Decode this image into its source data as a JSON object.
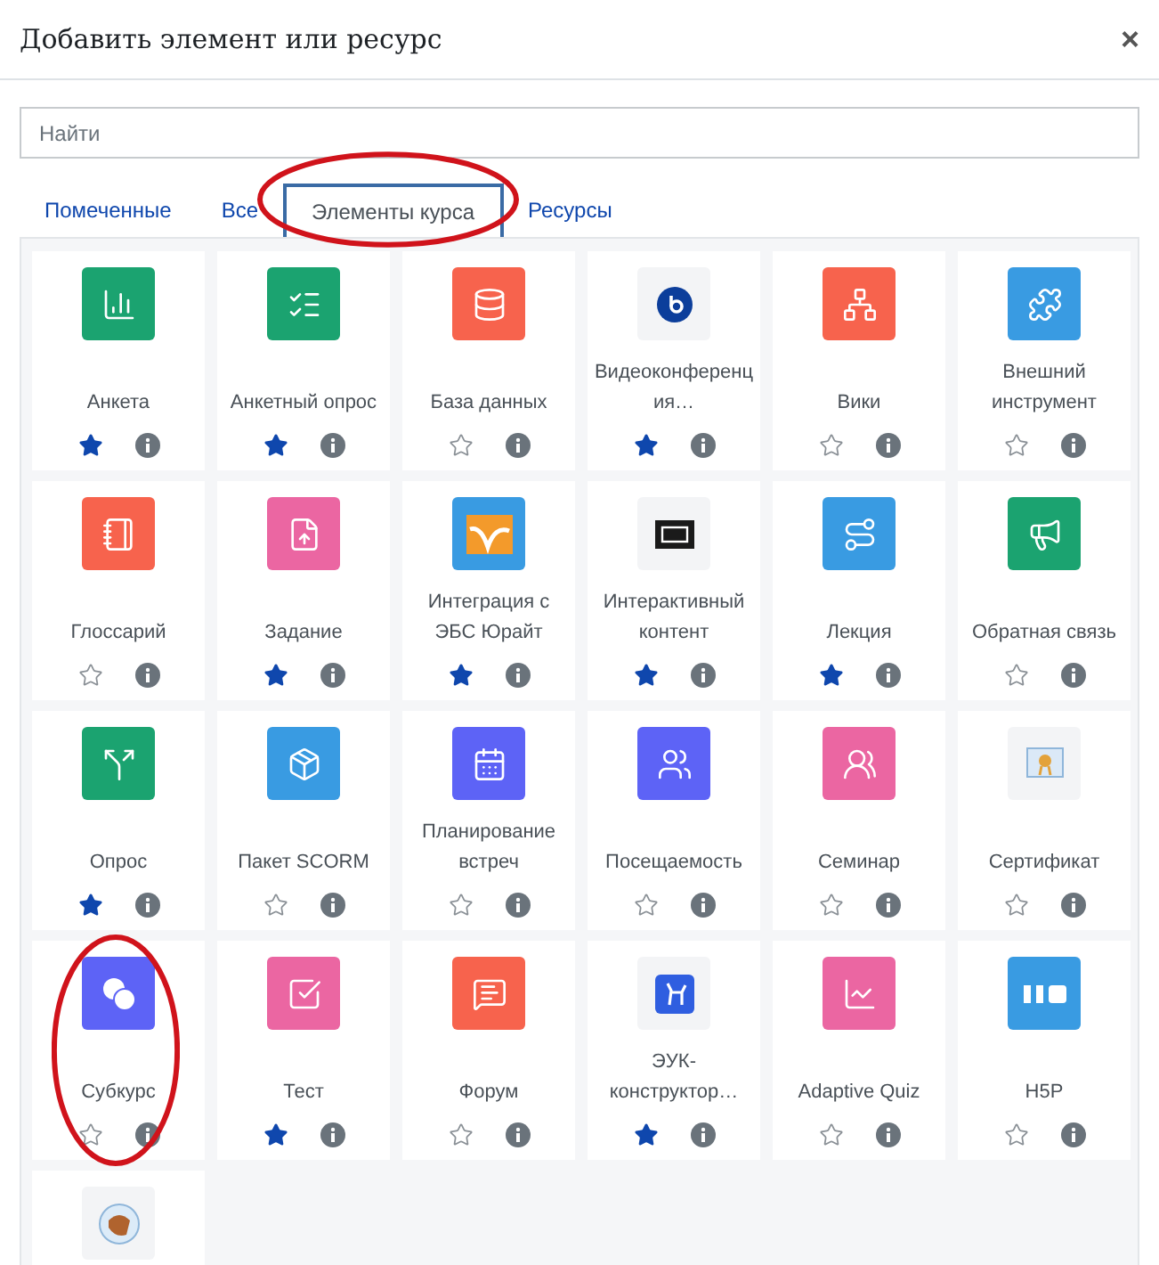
{
  "dialog": {
    "title": "Добавить элемент или ресурс",
    "close": "×"
  },
  "search": {
    "placeholder": "Найти"
  },
  "tabs": [
    {
      "label": "Помеченные",
      "selected": false,
      "circled": false
    },
    {
      "label": "Все",
      "selected": false,
      "circled": false
    },
    {
      "label": "Элементы курса",
      "selected": true,
      "circled": true
    },
    {
      "label": "Ресурсы",
      "selected": false,
      "circled": false
    }
  ],
  "items": [
    {
      "label": "Анкета",
      "starred": true,
      "kind": "tile",
      "color": "#1ba370",
      "circled": false
    },
    {
      "label": "Анкетный опрос",
      "starred": true,
      "kind": "tile",
      "color": "#1ba370",
      "circled": false
    },
    {
      "label": "База данных",
      "starred": false,
      "kind": "tile",
      "color": "#f7634d",
      "circled": false
    },
    {
      "label": "Видеоконференция…",
      "starred": true,
      "kind": "logo",
      "circled": false
    },
    {
      "label": "Вики",
      "starred": false,
      "kind": "tile",
      "color": "#f7634d",
      "circled": false
    },
    {
      "label": "Внешний инструмент",
      "starred": false,
      "kind": "tile",
      "color": "#399be2",
      "circled": false
    },
    {
      "label": "Глоссарий",
      "starred": false,
      "kind": "tile",
      "color": "#f7634d",
      "circled": false
    },
    {
      "label": "Задание",
      "starred": true,
      "kind": "tile",
      "color": "#eb66a2",
      "circled": false
    },
    {
      "label": "Интеграция с ЭБС Юрайт",
      "starred": true,
      "kind": "tile",
      "color": "#399be2",
      "circled": false
    },
    {
      "label": "Интерактивный контент",
      "starred": true,
      "kind": "logo",
      "circled": false
    },
    {
      "label": "Лекция",
      "starred": true,
      "kind": "tile",
      "color": "#399be2",
      "circled": false
    },
    {
      "label": "Обратная связь",
      "starred": false,
      "kind": "tile",
      "color": "#1ba370",
      "circled": false
    },
    {
      "label": "Опрос",
      "starred": true,
      "kind": "tile",
      "color": "#1ba370",
      "circled": false
    },
    {
      "label": "Пакет SCORM",
      "starred": false,
      "kind": "tile",
      "color": "#399be2",
      "circled": false
    },
    {
      "label": "Планирование встреч",
      "starred": false,
      "kind": "tile",
      "color": "#5d63f6",
      "circled": false
    },
    {
      "label": "Посещаемость",
      "starred": false,
      "kind": "tile",
      "color": "#5d63f6",
      "circled": false
    },
    {
      "label": "Семинар",
      "starred": false,
      "kind": "tile",
      "color": "#eb66a2",
      "circled": false
    },
    {
      "label": "Сертификат",
      "starred": false,
      "kind": "logo",
      "circled": false
    },
    {
      "label": "Субкурс",
      "starred": false,
      "kind": "tile",
      "color": "#5d63f6",
      "circled": true
    },
    {
      "label": "Тест",
      "starred": true,
      "kind": "tile",
      "color": "#eb66a2",
      "circled": false
    },
    {
      "label": "Форум",
      "starred": false,
      "kind": "tile",
      "color": "#f7634d",
      "circled": false
    },
    {
      "label": "ЭУК-конструктор…",
      "starred": true,
      "kind": "logo",
      "circled": false
    },
    {
      "label": "Adaptive Quiz",
      "starred": false,
      "kind": "tile",
      "color": "#eb66a2",
      "circled": false
    },
    {
      "label": "H5P",
      "starred": false,
      "kind": "tile",
      "color": "#399be2",
      "circled": false
    },
    {
      "kind": "logo",
      "circled": false
    }
  ]
}
